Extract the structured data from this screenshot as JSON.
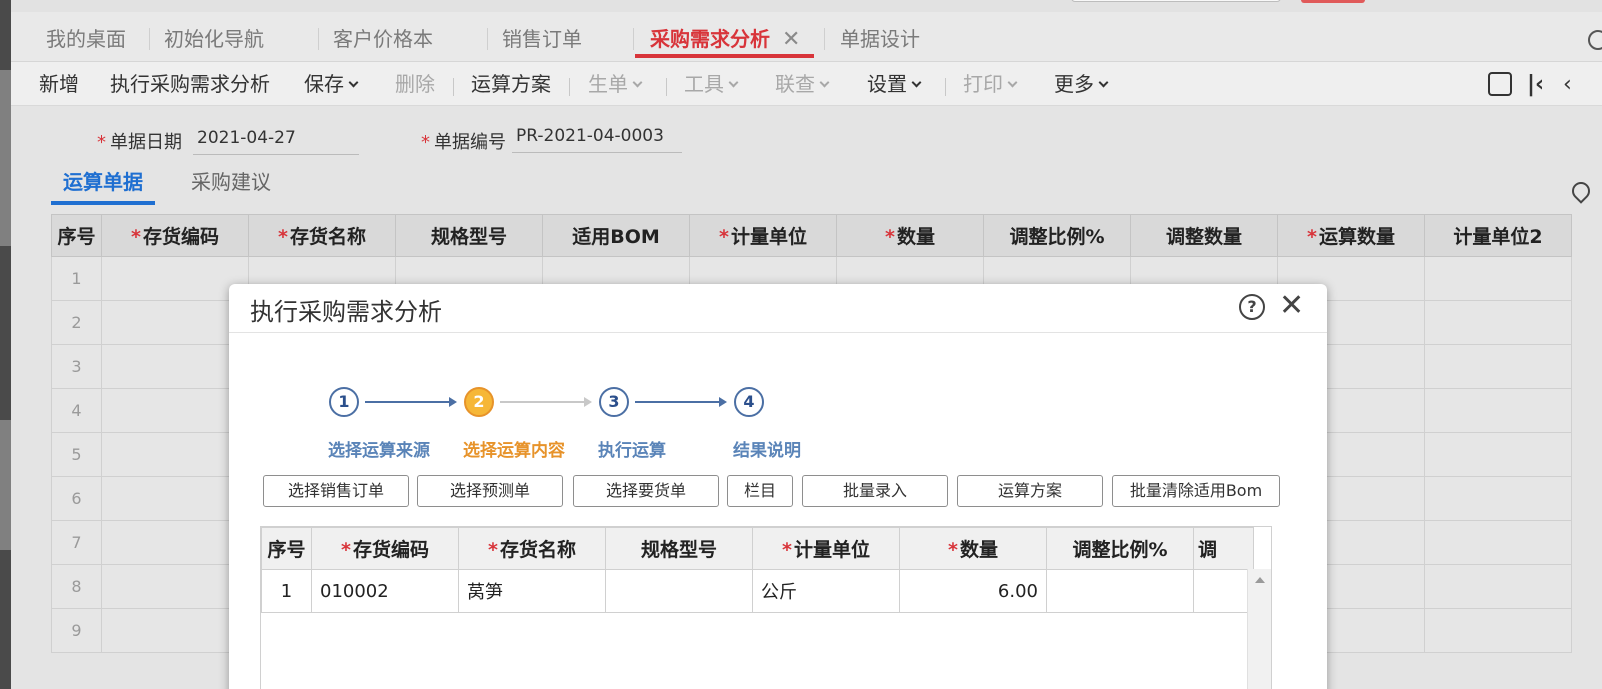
{
  "tabs": [
    {
      "label": "我的桌面"
    },
    {
      "label": "初始化导航"
    },
    {
      "label": "客户价格本"
    },
    {
      "label": "销售订单"
    },
    {
      "label": "采购需求分析",
      "close": "✕"
    },
    {
      "label": "单据设计"
    }
  ],
  "toolbar": {
    "new": "新增",
    "exec": "执行采购需求分析",
    "save": "保存",
    "delete": "删除",
    "plan": "运算方案",
    "gen": "生单",
    "tools": "工具",
    "query": "联查",
    "settings": "设置",
    "print": "打印",
    "more": "更多"
  },
  "form": {
    "date_label": "单据日期",
    "date_value": "2021-04-27",
    "no_label": "单据编号",
    "no_value": "PR-2021-04-0003",
    "required_mark": "*"
  },
  "subtabs": [
    "运算单据",
    "采购建议"
  ],
  "main_grid": {
    "headers": [
      {
        "label": "序号",
        "req": ""
      },
      {
        "label": "存货编码",
        "req": "*"
      },
      {
        "label": "存货名称",
        "req": "*"
      },
      {
        "label": "规格型号",
        "req": ""
      },
      {
        "label": "适用BOM",
        "req": ""
      },
      {
        "label": "计量单位",
        "req": "*"
      },
      {
        "label": "数量",
        "req": "*"
      },
      {
        "label": "调整比例%",
        "req": ""
      },
      {
        "label": "调整数量",
        "req": ""
      },
      {
        "label": "运算数量",
        "req": "*"
      },
      {
        "label": "计量单位2",
        "req": ""
      }
    ],
    "row_numbers": [
      "1",
      "2",
      "3",
      "4",
      "5",
      "6",
      "7",
      "8",
      "9"
    ]
  },
  "modal": {
    "title": "执行采购需求分析",
    "help": "?",
    "close": "✕",
    "steps": [
      {
        "num": "1",
        "label": "选择运算来源"
      },
      {
        "num": "2",
        "label": "选择运算内容"
      },
      {
        "num": "3",
        "label": "执行运算"
      },
      {
        "num": "4",
        "label": "结果说明"
      }
    ],
    "buttons": [
      "选择销售订单",
      "选择预测单",
      "选择要货单",
      "栏目",
      "批量录入",
      "运算方案",
      "批量清除适用Bom"
    ],
    "grid": {
      "headers": [
        {
          "label": "序号",
          "req": ""
        },
        {
          "label": "存货编码",
          "req": "*"
        },
        {
          "label": "存货名称",
          "req": "*"
        },
        {
          "label": "规格型号",
          "req": ""
        },
        {
          "label": "计量单位",
          "req": "*"
        },
        {
          "label": "数量",
          "req": "*"
        },
        {
          "label": "调整比例%",
          "req": ""
        },
        {
          "label": "调",
          "req": ""
        }
      ],
      "rows": [
        {
          "seq": "1",
          "code": "010002",
          "name": "莴笋",
          "spec": "",
          "unit": "公斤",
          "qty": "6.00",
          "ratio": "",
          "adj": ""
        }
      ]
    }
  },
  "colors": {
    "active_tab": "#d8343a",
    "active_subtab": "#1f6fd1",
    "step_current": "#f6b737",
    "step_done": "#4b6fa4"
  }
}
